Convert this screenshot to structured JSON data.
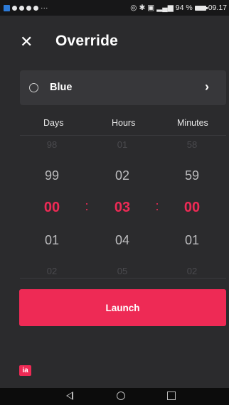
{
  "status_bar": {
    "left_overflow": "···",
    "battery": "94 %",
    "time": "09.17"
  },
  "app_bar": {
    "title": "Override",
    "close_icon": "close-icon"
  },
  "selector": {
    "label": "Blue",
    "icon": "chevron-right-icon"
  },
  "picker": {
    "headers": {
      "days": "Days",
      "hours": "Hours",
      "minutes": "Minutes"
    },
    "days": {
      "above2": "98",
      "above1": "99",
      "selected": "00",
      "below1": "01",
      "below2": "02"
    },
    "hours": {
      "above2": "01",
      "above1": "02",
      "selected": "03",
      "below1": "04",
      "below2": "05"
    },
    "minutes": {
      "above2": "58",
      "above1": "59",
      "selected": "00",
      "below1": "01",
      "below2": "02"
    },
    "separator": ":"
  },
  "launch_button": {
    "label": "Launch"
  },
  "logo": {
    "text": "ia"
  },
  "colors": {
    "accent": "#ee2a55",
    "background": "#2b2b2d",
    "card": "#37373a"
  }
}
